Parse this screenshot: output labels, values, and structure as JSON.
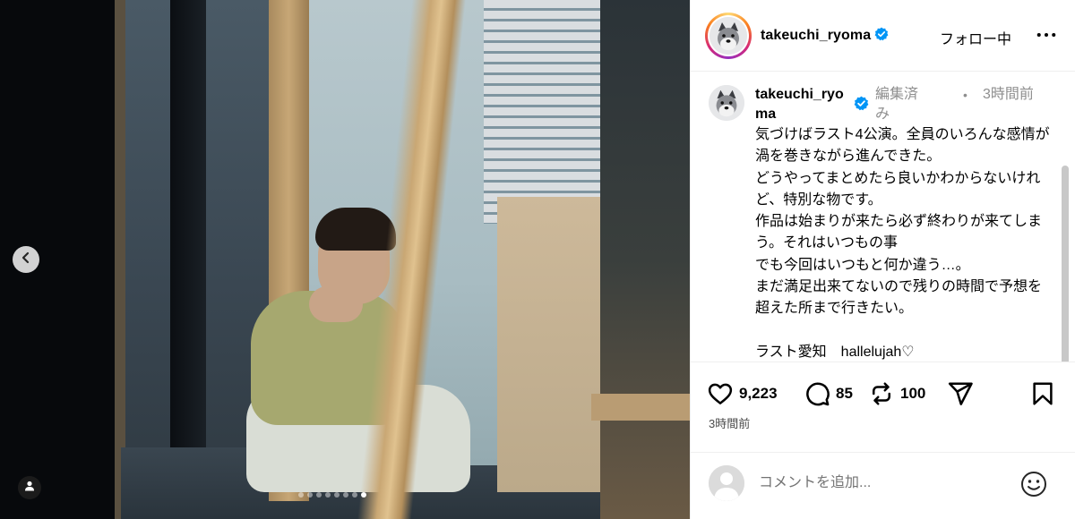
{
  "colors": {
    "verified_blue": "#0095f6",
    "text_primary": "#000000",
    "text_secondary": "#8e8e8e",
    "divider": "#efefef"
  },
  "media": {
    "carousel_total": 8,
    "carousel_active_index": 7,
    "prev_icon": "chevron-left-icon",
    "tag_icon": "user-tag-icon"
  },
  "header": {
    "username": "takeuchi_ryoma",
    "verified": true,
    "follow_label": "フォロー中",
    "more_icon": "more-horizontal-icon"
  },
  "caption": {
    "username": "takeuchi_ryoma",
    "edited_label": "編集済み",
    "separator": "•",
    "time": "3時間前",
    "text": "気づけばラスト4公演。全員のいろんな感情が渦を巻きながら進んできた。\nどうやってまとめたら良いかわからないけれど、特別な物です。\n作品は始まりが来たら必ず終わりが来てしまう。それはいつもの事\nでも今回はいつもと何か違う…。\nまだ満足出来てないので残りの時間で予想を超えた所まで行きたい。\n\nラスト愛知　hallelujah♡"
  },
  "actions": {
    "likes": "9,223",
    "comments": "85",
    "reposts": "100",
    "posted_ago": "3時間前"
  },
  "comment_box": {
    "placeholder": "コメントを追加..."
  }
}
